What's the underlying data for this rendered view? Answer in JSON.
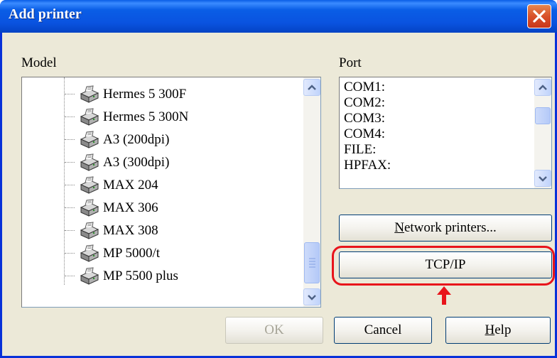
{
  "window": {
    "title": "Add printer",
    "close_label": "✕"
  },
  "model": {
    "label": "Model",
    "items": [
      "Hermes 5 300F",
      "Hermes 5 300N",
      "A3 (200dpi)",
      "A3 (300dpi)",
      "MAX 204",
      "MAX 306",
      "MAX 308",
      "MP 5000/t",
      "MP 5500 plus"
    ]
  },
  "port": {
    "label": "Port",
    "items": [
      "COM1:",
      "COM2:",
      "COM3:",
      "COM4:",
      "FILE:",
      "HPFAX:"
    ]
  },
  "buttons": {
    "network_printers": {
      "underlined": "N",
      "rest": "etwork printers..."
    },
    "tcpip": "TCP/IP",
    "ok": "OK",
    "cancel": "Cancel",
    "help": {
      "underlined": "H",
      "rest": "elp"
    }
  },
  "annotation": {
    "highlight_color": "#e8141b",
    "arrow_icon": "red-up-arrow-icon"
  },
  "colors": {
    "titlebar": "#0a5ee6",
    "dialog_bg": "#ece9d8",
    "close_button": "#d9512a"
  }
}
